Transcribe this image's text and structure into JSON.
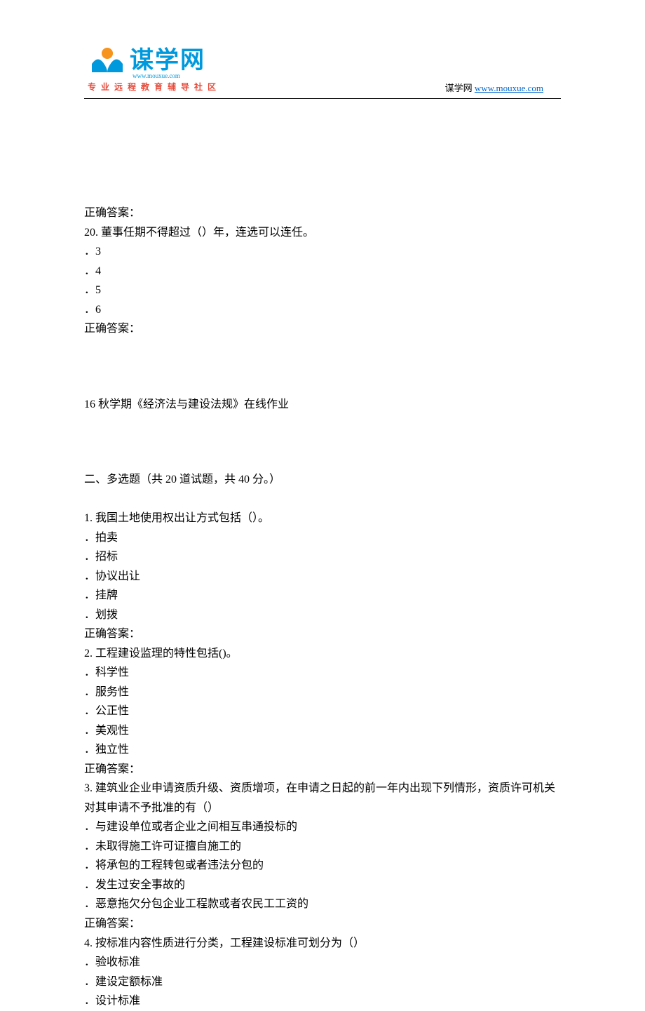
{
  "header": {
    "logo_text": "谋学网",
    "logo_sub": "www.mouxue.com",
    "tagline": "专业远程教育辅导社区",
    "site_label": "谋学网",
    "site_url_text": "www.mouxue.com",
    "site_url_href": "http://www.mouxue.com"
  },
  "body": {
    "correct_answer_label": "正确答案：",
    "q20": {
      "stem": "20.  董事任期不得超过（）年，连选可以连任。",
      "options": [
        "．3",
        "．4",
        "．5",
        "．6"
      ]
    },
    "assignment_title": "16 秋学期《经济法与建设法规》在线作业",
    "section2_title": "二、多选题（共 20 道试题，共 40 分。）",
    "mc": [
      {
        "stem": "1.  我国土地使用权出让方式包括（）。",
        "options": [
          "．拍卖",
          "．招标",
          "．协议出让",
          "．挂牌",
          "．划拨"
        ]
      },
      {
        "stem": "2.  工程建设监理的特性包括()。",
        "options": [
          "．科学性",
          "．服务性",
          "．公正性",
          "．美观性",
          "．独立性"
        ]
      },
      {
        "stem": "3.  建筑业企业申请资质升级、资质增项，在申请之日起的前一年内出现下列情形，资质许可机关对其申请不予批准的有（）",
        "options": [
          "．与建设单位或者企业之间相互串通投标的",
          "．未取得施工许可证擅自施工的",
          "．将承包的工程转包或者违法分包的",
          "．发生过安全事故的",
          "．恶意拖欠分包企业工程款或者农民工工资的"
        ]
      },
      {
        "stem": "4.  按标准内容性质进行分类，工程建设标准可划分为（）",
        "options": [
          "．验收标准",
          "．建设定额标准",
          "．设计标准"
        ]
      }
    ]
  }
}
